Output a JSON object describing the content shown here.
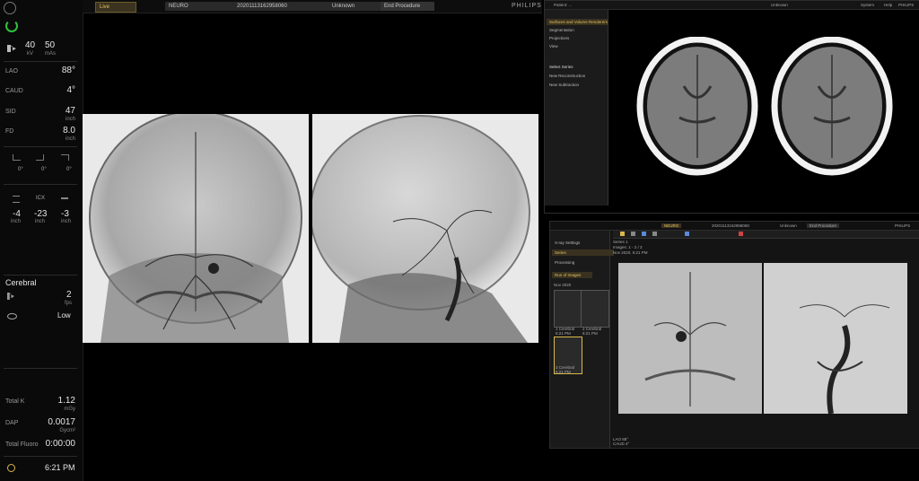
{
  "left": {
    "kv": "40",
    "kv_unit": "kV",
    "mas": "50",
    "mas_unit": "mAs",
    "lao_label": "LAO",
    "lao_value": "88°",
    "caud_label": "CAUD",
    "caud_value": "4°",
    "sid_label": "SID",
    "sid_value": "47",
    "sid_unit": "inch",
    "fd_label": "FD",
    "fd_value": "8.0",
    "fd_unit": "inch",
    "angles": [
      "0°",
      "0°",
      "0°"
    ],
    "table": {
      "values": [
        "-4",
        "-23",
        "-3"
      ],
      "units": [
        "inch",
        "inch",
        "inch"
      ],
      "mid_label": "ICX"
    },
    "protocol": "Cerebral",
    "fps_value": "2",
    "fps_unit": "fps",
    "dose_level": "Low",
    "total_k_label": "Total K",
    "total_k_value": "1.12",
    "total_k_unit": "mGy",
    "dap_label": "DAP",
    "dap_value": "0.0017",
    "dap_unit": "Gycm²",
    "fluoro_label": "Total Fluoro",
    "fluoro_value": "0:00:00",
    "time": "6:21 PM"
  },
  "topbar": {
    "live_tab": "Live",
    "patient_tab": "NEURO",
    "study_id": "20201113162958060",
    "unknown": "Unknown",
    "end_procedure": "End Procedure",
    "brand": "PHILIPS"
  },
  "ct": {
    "header_text": "Patient: ...",
    "unknown": "Unknown",
    "menu_items": [
      "System",
      "Help"
    ],
    "brand": "PHILIPS",
    "side_items": [
      "Surfaces and Volume Renderers",
      "Segmentation",
      "Projections",
      "View"
    ],
    "series_label": "Select Series",
    "series_items": [
      "New Reconstruction",
      "New Subtraction"
    ]
  },
  "review": {
    "live_tab": "NEURO",
    "study_id": "20201113162958060",
    "unknown": "Unknown",
    "end_procedure": "End Procedure",
    "brand": "PHILIPS",
    "menu": [
      "X-ray Settings",
      "Series",
      "Processing"
    ],
    "dropdown": "Run of Images",
    "date_label": "Nov 2020",
    "series_info": [
      "Series 1",
      "Images: 1 - 2 / 2",
      "Nov 2020, 6:21 PM"
    ],
    "thumbs": [
      {
        "label": "1 Cerebral",
        "time": "6:21 PM"
      },
      {
        "label": "2 Cerebral",
        "time": "6:21 PM"
      },
      {
        "label": "3 Cerebral",
        "time": "6:21 PM"
      }
    ],
    "lao_info": "LAO 88°",
    "caud_info": "CAUD 4°"
  }
}
